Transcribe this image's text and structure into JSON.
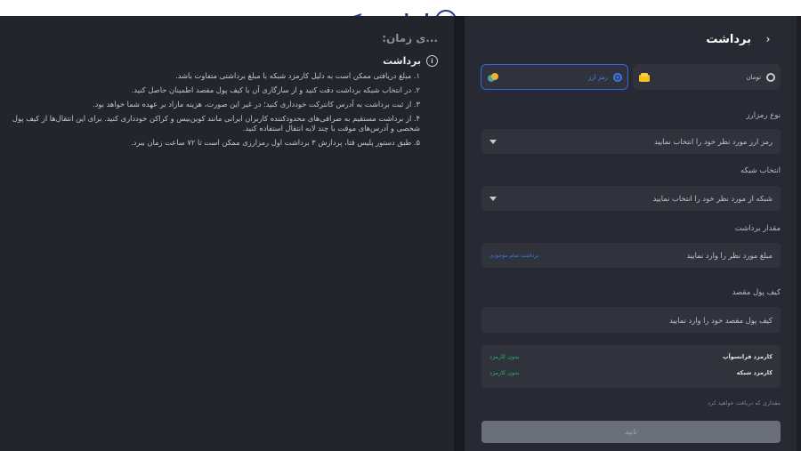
{
  "brand": {
    "logo_text": "ایران بروکر"
  },
  "info": {
    "heading_faded": "...ی زمان:",
    "title": "برداشت",
    "items": [
      "۱. مبلغ دریافتی ممکن است به دلیل کارمزد شبکه با مبلغ برداشتی متفاوت باشد.",
      "۲. در انتخاب شبکه برداشت دقت کنید و از سازگاری آن با کیف پول مقصد اطمینان حاصل کنید.",
      "۳. از ثبت برداشت به آدرس کانترکت خودداری کنید؛ در غیر این صورت، هزینه مازاد بر عهده شما خواهد بود.",
      "۴. از برداشت مستقیم به صرافی‌های محدودکننده کاربران ایرانی مانند کوین‌بیس و کراکن خودداری کنید. برای این انتقال‌ها از کیف پول شخصی و آدرس‌های موقت با چند لایه انتقال استفاده کنید.",
      "۵. طبق دستور پلیس فتا، پردازش ۳ برداشت اول رمزارزی ممکن است تا ۷۲ ساعت زمان ببرد."
    ]
  },
  "form": {
    "title": "برداشت",
    "currency": {
      "toman_label": "تومان",
      "crypto_label": "رمز ارز",
      "selected": "crypto"
    },
    "crypto_type": {
      "label": "نوع رمزارز",
      "placeholder": "رمز ارز مورد نظر خود را انتخاب نمایید"
    },
    "network": {
      "label": "انتخاب شبکه",
      "placeholder": "شبکه از مورد نظر خود را انتخاب نمایید"
    },
    "amount": {
      "label": "مقدار برداشت",
      "placeholder": "مبلغ مورد نظر را وارد نمایید",
      "max_link": "برداشت تمام موجودی"
    },
    "wallet": {
      "label": "کیف پول مقصد",
      "placeholder": "کیف پول مقصد خود را وارد نمایید"
    },
    "fees": [
      {
        "key": "کارمزد فرانسوآپ",
        "value": "بدون کارمزد"
      },
      {
        "key": "کارمزد شبکه",
        "value": "بدون کارمزد"
      }
    ],
    "receive_text": "مقداری که دریافت خواهید کرد",
    "confirm_label": "تایید"
  },
  "colors": {
    "accent": "#2d6ae0",
    "fee_green": "#23b36b",
    "brand_blue": "#1b3a8f"
  }
}
